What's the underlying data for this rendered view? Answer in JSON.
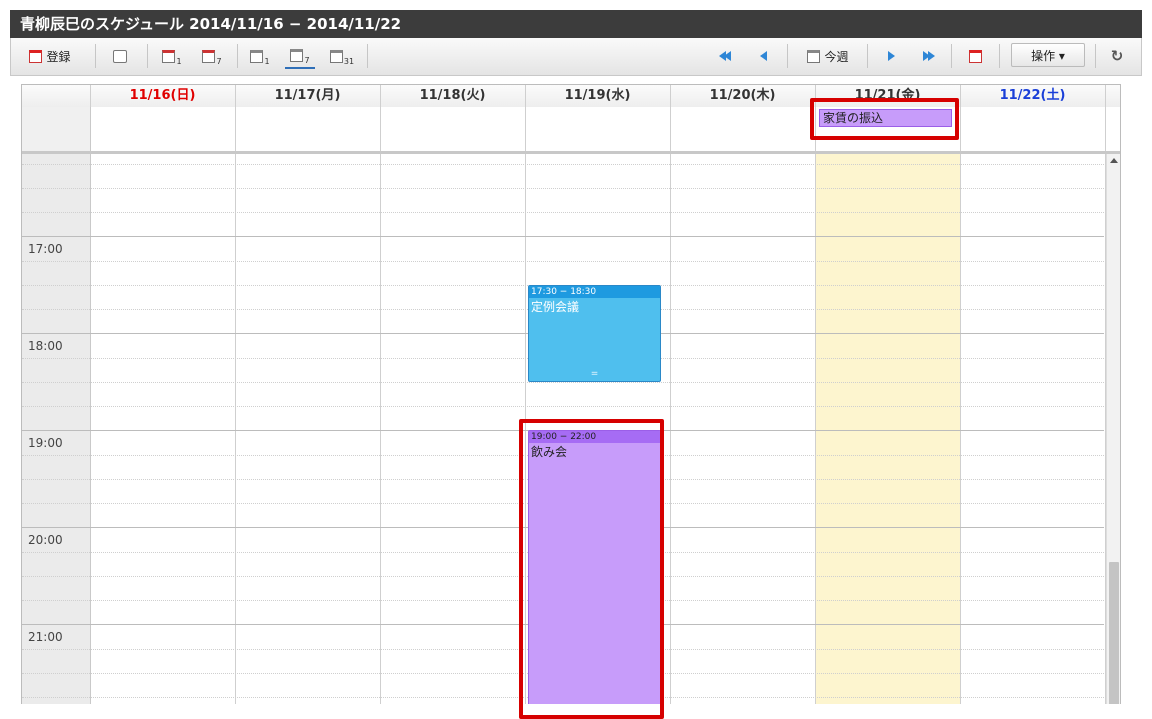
{
  "window": {
    "title": "青柳辰巳のスケジュール 2014/11/16 − 2014/11/22"
  },
  "toolbar": {
    "register_label": "登録",
    "today_label": "今週",
    "operation_label": "操作 ▾",
    "view_subs": {
      "day_group": "1",
      "week_group": "7",
      "day": "1",
      "week": "7",
      "month": "31"
    }
  },
  "calendar": {
    "days": [
      {
        "label": "11/16(日)",
        "kind": "sun"
      },
      {
        "label": "11/17(月)",
        "kind": "weekday"
      },
      {
        "label": "11/18(火)",
        "kind": "weekday"
      },
      {
        "label": "11/19(水)",
        "kind": "weekday"
      },
      {
        "label": "11/20(木)",
        "kind": "weekday"
      },
      {
        "label": "11/21(金)",
        "kind": "weekday"
      },
      {
        "label": "11/22(土)",
        "kind": "sat"
      }
    ],
    "hours": [
      "17:00",
      "18:00",
      "19:00",
      "20:00",
      "21:00"
    ],
    "today_index": 5,
    "allday_event": {
      "title": "家賃の振込",
      "day_index": 5
    },
    "events": [
      {
        "time": "17:30 − 18:30",
        "title": "定例会議",
        "day_index": 3,
        "color": "blue"
      },
      {
        "time": "19:00 − 22:00",
        "title": "飲み会",
        "day_index": 3,
        "color": "purple"
      }
    ]
  },
  "colors": {
    "sunday": "#e00000",
    "saturday": "#1a3fd8",
    "today_bg": "#fdf5cf",
    "event_blue": "#4fbfee",
    "event_purple": "#c79cfa",
    "highlight": "#d60000"
  }
}
